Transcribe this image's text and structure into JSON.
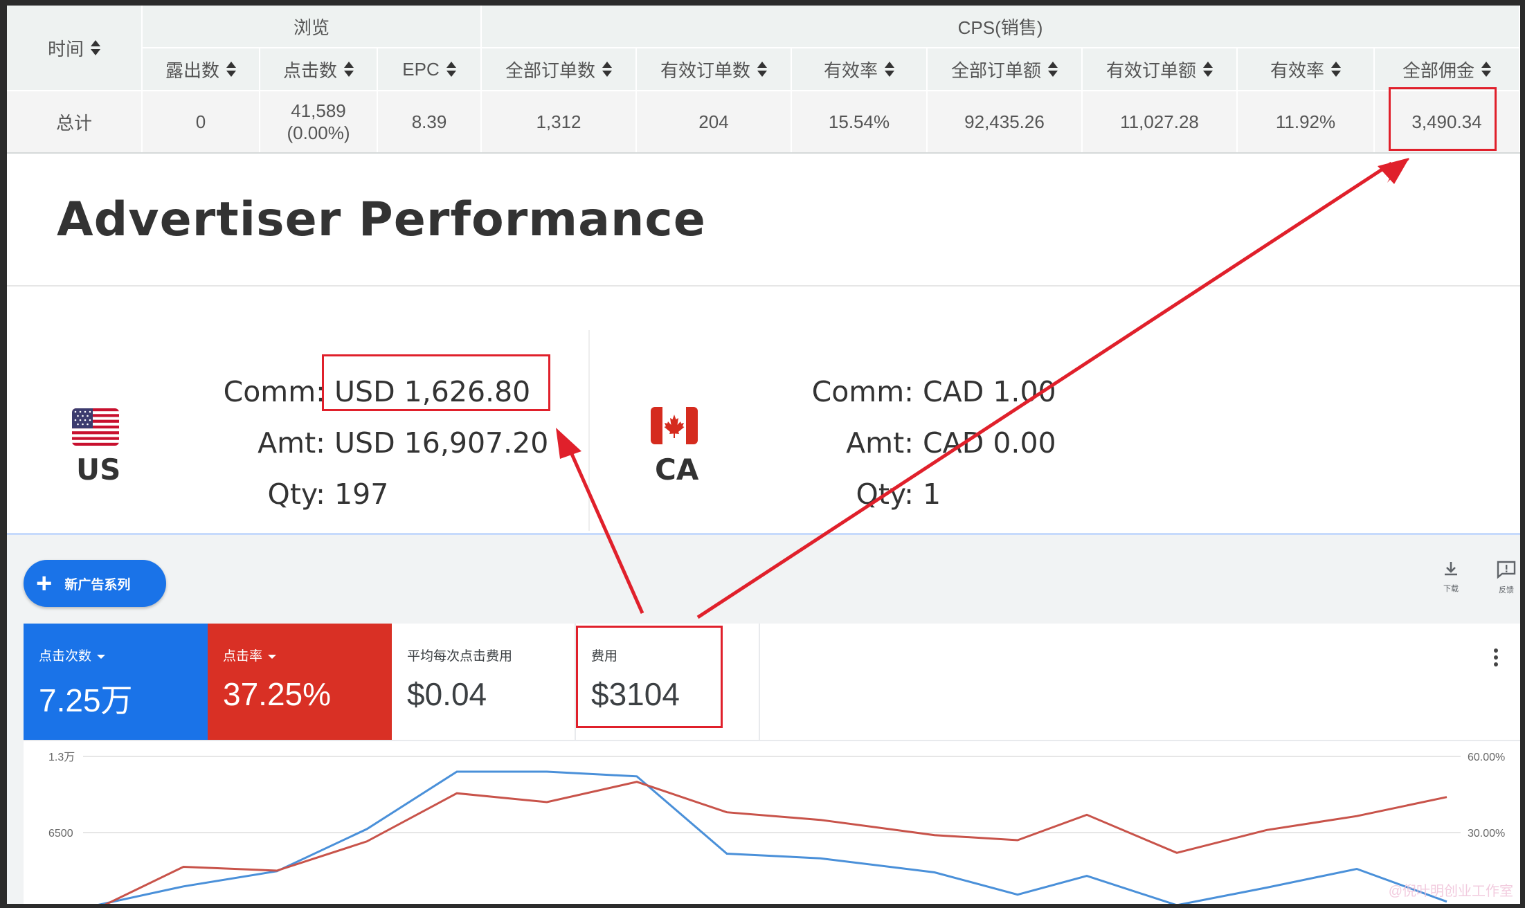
{
  "stats_table": {
    "col_time": "时间",
    "group_browse": "浏览",
    "group_cps": "CPS(销售)",
    "headers": [
      "露出数",
      "点击数",
      "EPC",
      "全部订单数",
      "有效订单数",
      "有效率",
      "全部订单额",
      "有效订单额",
      "有效率",
      "全部佣金"
    ],
    "total_label": "总计",
    "total_values": [
      "0",
      "41,589",
      "8.39",
      "1,312",
      "204",
      "15.54%",
      "92,435.26",
      "11,027.28",
      "11.92%",
      "3,490.34"
    ],
    "clicks_pct": "(0.00%)"
  },
  "advertiser": {
    "title": "Advertiser Performance",
    "countries": [
      {
        "code": "US",
        "comm_label": "Comm:",
        "comm": "USD 1,626.80",
        "amt_label": "Amt:",
        "amt": "USD 16,907.20",
        "qty_label": "Qty:",
        "qty": "197"
      },
      {
        "code": "CA",
        "comm_label": "Comm:",
        "comm": "CAD 1.00",
        "amt_label": "Amt:",
        "amt": "CAD 0.00",
        "qty_label": "Qty:",
        "qty": "1"
      }
    ]
  },
  "ads": {
    "new_campaign": "新广告系列",
    "download_label": "下载",
    "feedback_label": "反馈",
    "metrics": [
      {
        "label": "点击次数",
        "value": "7.25万",
        "bg": "#1a73e8",
        "fg": "#ffffff",
        "dropdown": true
      },
      {
        "label": "点击率",
        "value": "37.25%",
        "bg": "#d93025",
        "fg": "#ffffff",
        "dropdown": true
      },
      {
        "label": "平均每次点击费用",
        "value": "$0.04",
        "bg": "#ffffff",
        "fg": "#3c4043",
        "dropdown": false
      },
      {
        "label": "费用",
        "value": "$3104",
        "bg": "#ffffff",
        "fg": "#3c4043",
        "dropdown": false
      }
    ]
  },
  "chart_data": {
    "type": "line",
    "left_axis_ticks": [
      "1.3万",
      "6500"
    ],
    "right_axis_ticks": [
      "60.00%",
      "30.00%"
    ],
    "ylim_left": [
      0,
      13000
    ],
    "ylim_right": [
      0,
      60
    ],
    "series": [
      {
        "values": [
          300,
          1900,
          3200,
          6800,
          11700,
          11700,
          11300,
          4700,
          4300,
          3100,
          1200,
          2800,
          300,
          1800,
          3400,
          600
        ],
        "color": "#4a90d9"
      },
      {
        "values": [
          0,
          16.5,
          15.0,
          26.5,
          45.5,
          42.0,
          50.0,
          38.0,
          35.0,
          29.0,
          27.0,
          37.0,
          22.0,
          31.0,
          36.5,
          44.0
        ],
        "color": "#c8534a"
      }
    ]
  },
  "watermark": "@倪叶明创业工作室",
  "colors": {
    "annotation": "#e0202b",
    "table_header_bg": "#eef2f1"
  }
}
